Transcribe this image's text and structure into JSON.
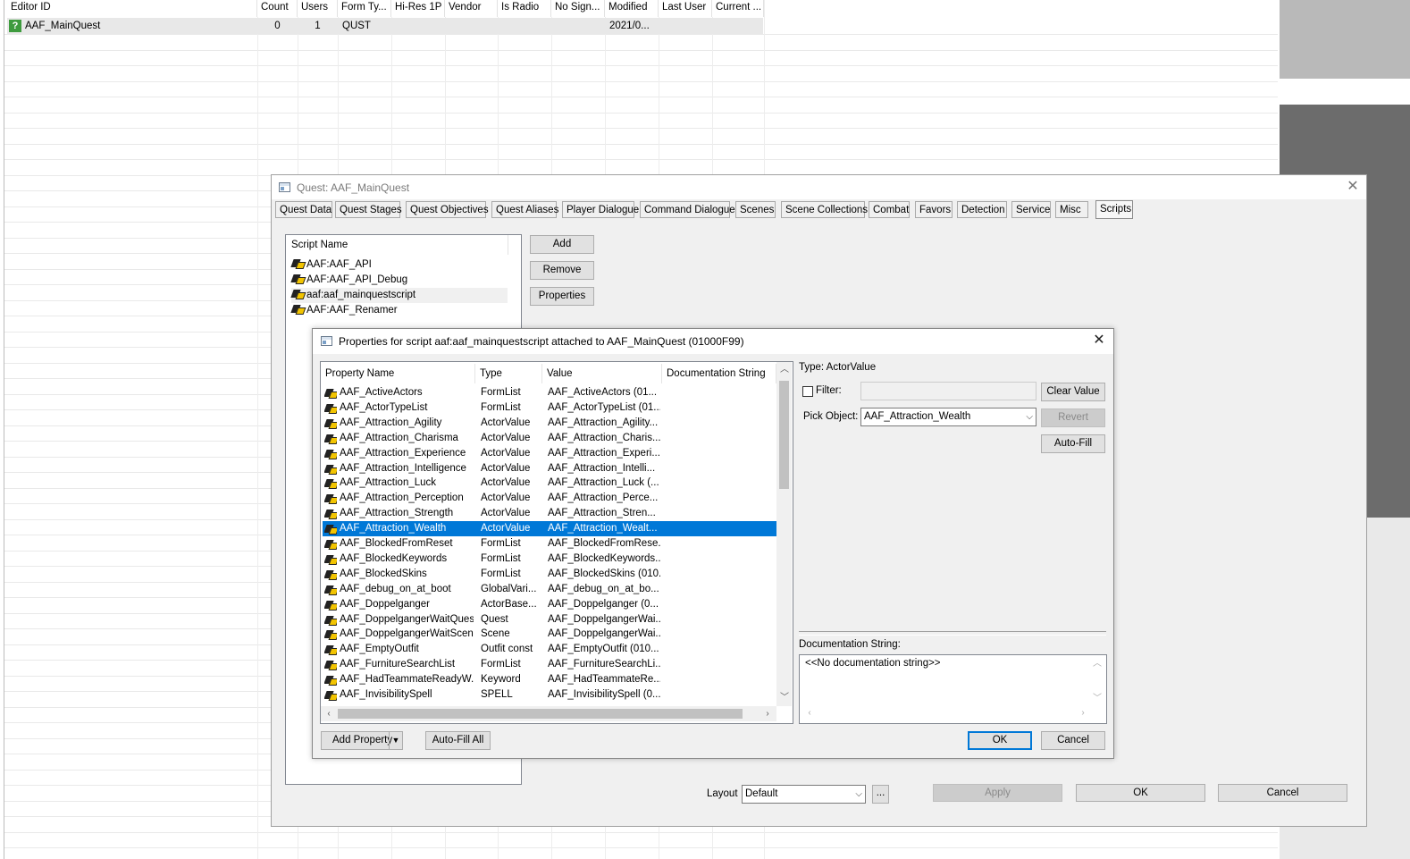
{
  "object_list": {
    "columns": [
      "Editor ID",
      "Count",
      "Users",
      "Form Ty...",
      "Hi-Res 1P",
      "Vendor",
      "Is Radio",
      "No Sign...",
      "Modified",
      "Last User",
      "Current ..."
    ],
    "row": {
      "editor_id": "AAF_MainQuest",
      "count": "0",
      "users": "1",
      "form_type": "QUST",
      "modified": "2021/0..."
    },
    "row_icon": "?"
  },
  "quest_window": {
    "title": "Quest: AAF_MainQuest",
    "tabs": [
      "Quest Data",
      "Quest Stages",
      "Quest Objectives",
      "Quest Aliases",
      "Player Dialogue",
      "Command Dialogue",
      "Scenes",
      "Scene Collections",
      "Combat",
      "Favors",
      "Detection",
      "Service",
      "Misc",
      "Scripts"
    ],
    "active_tab": "Scripts",
    "scripts_header": "Script Name",
    "scripts": [
      "AAF:AAF_API",
      "AAF:AAF_API_Debug",
      "aaf:aaf_mainquestscript",
      "AAF:AAF_Renamer"
    ],
    "buttons": {
      "add": "Add",
      "remove": "Remove",
      "properties": "Properties"
    },
    "layout_label": "Layout",
    "layout_value": "Default",
    "ellipsis": "...",
    "apply": "Apply",
    "ok": "OK",
    "cancel": "Cancel"
  },
  "properties_dialog": {
    "title": "Properties for script aaf:aaf_mainquestscript attached to AAF_MainQuest (01000F99)",
    "columns": {
      "name": "Property Name",
      "type": "Type",
      "value": "Value",
      "doc": "Documentation String"
    },
    "selected_index": 9,
    "properties": [
      {
        "name": "AAF_ActiveActors",
        "type": "FormList",
        "value": "AAF_ActiveActors (01..."
      },
      {
        "name": "AAF_ActorTypeList",
        "type": "FormList",
        "value": "AAF_ActorTypeList (01..."
      },
      {
        "name": "AAF_Attraction_Agility",
        "type": "ActorValue",
        "value": "AAF_Attraction_Agility..."
      },
      {
        "name": "AAF_Attraction_Charisma",
        "type": "ActorValue",
        "value": "AAF_Attraction_Charis..."
      },
      {
        "name": "AAF_Attraction_Experience",
        "type": "ActorValue",
        "value": "AAF_Attraction_Experi..."
      },
      {
        "name": "AAF_Attraction_Intelligence",
        "type": "ActorValue",
        "value": "AAF_Attraction_Intelli..."
      },
      {
        "name": "AAF_Attraction_Luck",
        "type": "ActorValue",
        "value": "AAF_Attraction_Luck (..."
      },
      {
        "name": "AAF_Attraction_Perception",
        "type": "ActorValue",
        "value": "AAF_Attraction_Perce..."
      },
      {
        "name": "AAF_Attraction_Strength",
        "type": "ActorValue",
        "value": "AAF_Attraction_Stren..."
      },
      {
        "name": "AAF_Attraction_Wealth",
        "type": "ActorValue",
        "value": "AAF_Attraction_Wealt..."
      },
      {
        "name": "AAF_BlockedFromReset",
        "type": "FormList",
        "value": "AAF_BlockedFromRese..."
      },
      {
        "name": "AAF_BlockedKeywords",
        "type": "FormList",
        "value": "AAF_BlockedKeywords..."
      },
      {
        "name": "AAF_BlockedSkins",
        "type": "FormList",
        "value": "AAF_BlockedSkins (010..."
      },
      {
        "name": "AAF_debug_on_at_boot",
        "type": "GlobalVari...",
        "value": "AAF_debug_on_at_bo..."
      },
      {
        "name": "AAF_Doppelganger",
        "type": "ActorBase...",
        "value": "AAF_Doppelganger (0..."
      },
      {
        "name": "AAF_DoppelgangerWaitQuest",
        "type": "Quest",
        "value": "AAF_DoppelgangerWai..."
      },
      {
        "name": "AAF_DoppelgangerWaitScene",
        "type": "Scene",
        "value": "AAF_DoppelgangerWai..."
      },
      {
        "name": "AAF_EmptyOutfit",
        "type": "Outfit const",
        "value": "AAF_EmptyOutfit (010..."
      },
      {
        "name": "AAF_FurnitureSearchList",
        "type": "FormList",
        "value": "AAF_FurnitureSearchLi..."
      },
      {
        "name": "AAF_HadTeammateReadyW...",
        "type": "Keyword",
        "value": "AAF_HadTeammateRe..."
      },
      {
        "name": "AAF_InvisibilitySpell",
        "type": "SPELL",
        "value": "AAF_InvisibilitySpell (0..."
      }
    ],
    "type_label": "Type: ActorValue",
    "filter_label": "Filter:",
    "filter_value": "",
    "clear_value": "Clear Value",
    "pick_object_label": "Pick Object:",
    "pick_object_value": "AAF_Attraction_Wealth",
    "revert": "Revert",
    "auto_fill": "Auto-Fill",
    "doc_label": "Documentation String:",
    "doc_value": "<<No documentation string>>",
    "add_property": "Add Property",
    "auto_fill_all": "Auto-Fill All",
    "ok": "OK",
    "cancel": "Cancel"
  },
  "colors": {
    "selection": "#0078d7",
    "window_bg": "#f0f0f0",
    "ok_focus_border": "#0078d7"
  }
}
